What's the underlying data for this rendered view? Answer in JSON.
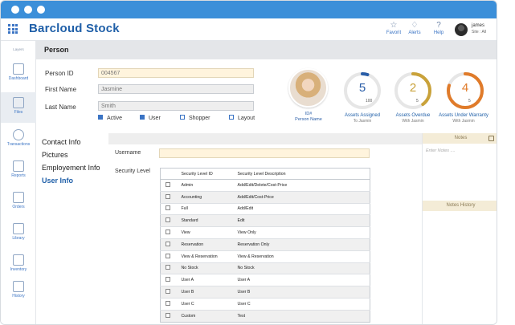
{
  "app": {
    "title": "Barcloud Stock"
  },
  "header": {
    "buttons": [
      {
        "label": "Favorit",
        "icon": "star-icon"
      },
      {
        "label": "Alerts",
        "icon": "bell-icon"
      },
      {
        "label": "Help",
        "icon": "help-icon"
      }
    ],
    "user": {
      "name": "james",
      "site": "Site : All"
    }
  },
  "sidebar": {
    "top_label": "Layers",
    "items": [
      {
        "label": "Dashboard",
        "icon": "home-icon"
      },
      {
        "label": "Files",
        "icon": "folder-icon",
        "active": true
      },
      {
        "label": "Transactions",
        "icon": "transaction-icon"
      },
      {
        "label": "Reports",
        "icon": "chart-icon"
      },
      {
        "label": "Orders",
        "icon": "document-icon"
      },
      {
        "label": "Library",
        "icon": "image-icon"
      },
      {
        "label": "Inventory",
        "icon": "calendar-icon"
      },
      {
        "label": "History",
        "icon": "list-icon"
      }
    ]
  },
  "page": {
    "title": "Person"
  },
  "form": {
    "person_id": {
      "label": "Person ID",
      "value": "004567"
    },
    "first_name": {
      "label": "First Name",
      "value": "Jasmine"
    },
    "last_name": {
      "label": "Last Name",
      "value": "Smith"
    },
    "checks": [
      {
        "label": "Active",
        "checked": true
      },
      {
        "label": "User",
        "checked": true
      },
      {
        "label": "Shopper",
        "checked": false
      },
      {
        "label": "Layout",
        "checked": false
      }
    ]
  },
  "profile": {
    "id_label": "ID#",
    "name_label": "Person Name"
  },
  "kpis": [
    {
      "value": "5",
      "total": "100",
      "title": "Assets Assigned",
      "sub": "To Jasmin",
      "color": "#2a5ea8"
    },
    {
      "value": "2",
      "total": "5",
      "title": "Assets Overdue",
      "sub": "With Jasmin",
      "color": "#c9a23a"
    },
    {
      "value": "4",
      "total": "5",
      "title": "Assets Under Warranty",
      "sub": "With Jasmin",
      "color": "#e07b2a"
    }
  ],
  "left_nav": {
    "items": [
      {
        "label": "Contact Info"
      },
      {
        "label": "Pictures"
      },
      {
        "label": "Employement Info"
      },
      {
        "label": "User Info",
        "active": true
      }
    ]
  },
  "user_info": {
    "username_label": "Username",
    "username_value": "",
    "security_label": "Security Level",
    "table": {
      "headers": [
        "",
        "Security Level ID",
        "Security Level Description"
      ],
      "rows": [
        {
          "id": "Admin",
          "desc": "Add/Edit/Delete/Cost-Price"
        },
        {
          "id": "Accounting",
          "desc": "Add/Edit/Cost-Price"
        },
        {
          "id": "Full",
          "desc": "Add/Edit"
        },
        {
          "id": "Standard",
          "desc": "Edit"
        },
        {
          "id": "View",
          "desc": "View Only"
        },
        {
          "id": "Reservation",
          "desc": "Reservation Only"
        },
        {
          "id": "View & Reservation",
          "desc": "View & Reservation"
        },
        {
          "id": "No Stock",
          "desc": "No Stock"
        },
        {
          "id": "User A",
          "desc": "User A"
        },
        {
          "id": "User B",
          "desc": "User B"
        },
        {
          "id": "User C",
          "desc": "User C"
        },
        {
          "id": "Custom",
          "desc": "Test"
        }
      ]
    }
  },
  "notes": {
    "title": "Notes",
    "placeholder": "Enter Notes ....",
    "history_title": "Notes History"
  }
}
